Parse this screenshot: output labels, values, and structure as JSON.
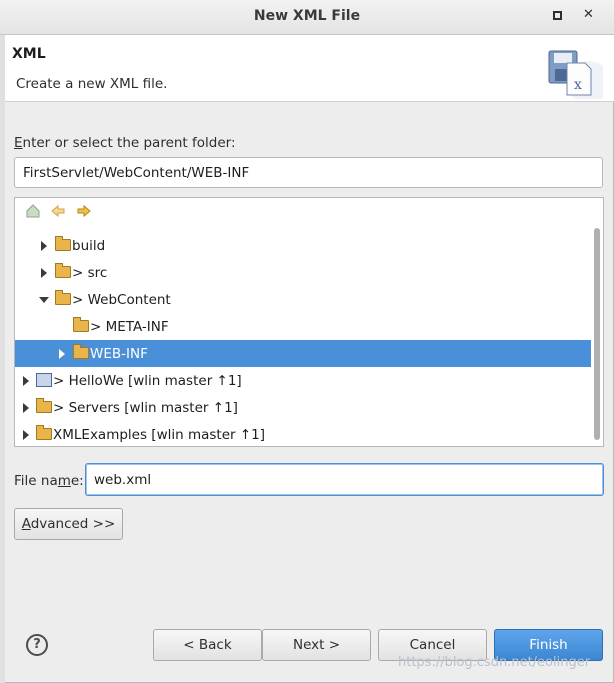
{
  "window": {
    "title": "New XML File"
  },
  "banner": {
    "title": "XML",
    "description": "Create a new XML file."
  },
  "folder": {
    "label_prefix": "E",
    "label_rest": "nter or select the parent folder:",
    "value": "FirstServlet/WebContent/WEB-INF"
  },
  "tree": {
    "rows": [
      {
        "label": "build"
      },
      {
        "label": "> src"
      },
      {
        "label": "> WebContent"
      },
      {
        "label": "> META-INF"
      },
      {
        "label": "WEB-INF"
      },
      {
        "label": "> HelloWe [wlin master ↑1]"
      },
      {
        "label": "> Servers [wlin master ↑1]"
      },
      {
        "label": "XMLExamples [wlin master ↑1]"
      }
    ]
  },
  "file": {
    "label_start": "File na",
    "label_underlined": "m",
    "label_end": "e:",
    "value": "web.xml"
  },
  "buttons": {
    "advanced_u": "A",
    "advanced_rest": "dvanced >>",
    "back": "< Back",
    "next": "Next >",
    "cancel": "Cancel",
    "finish": "Finish",
    "help": "?"
  },
  "watermark": "https://blog.csdn.net/eolinger"
}
